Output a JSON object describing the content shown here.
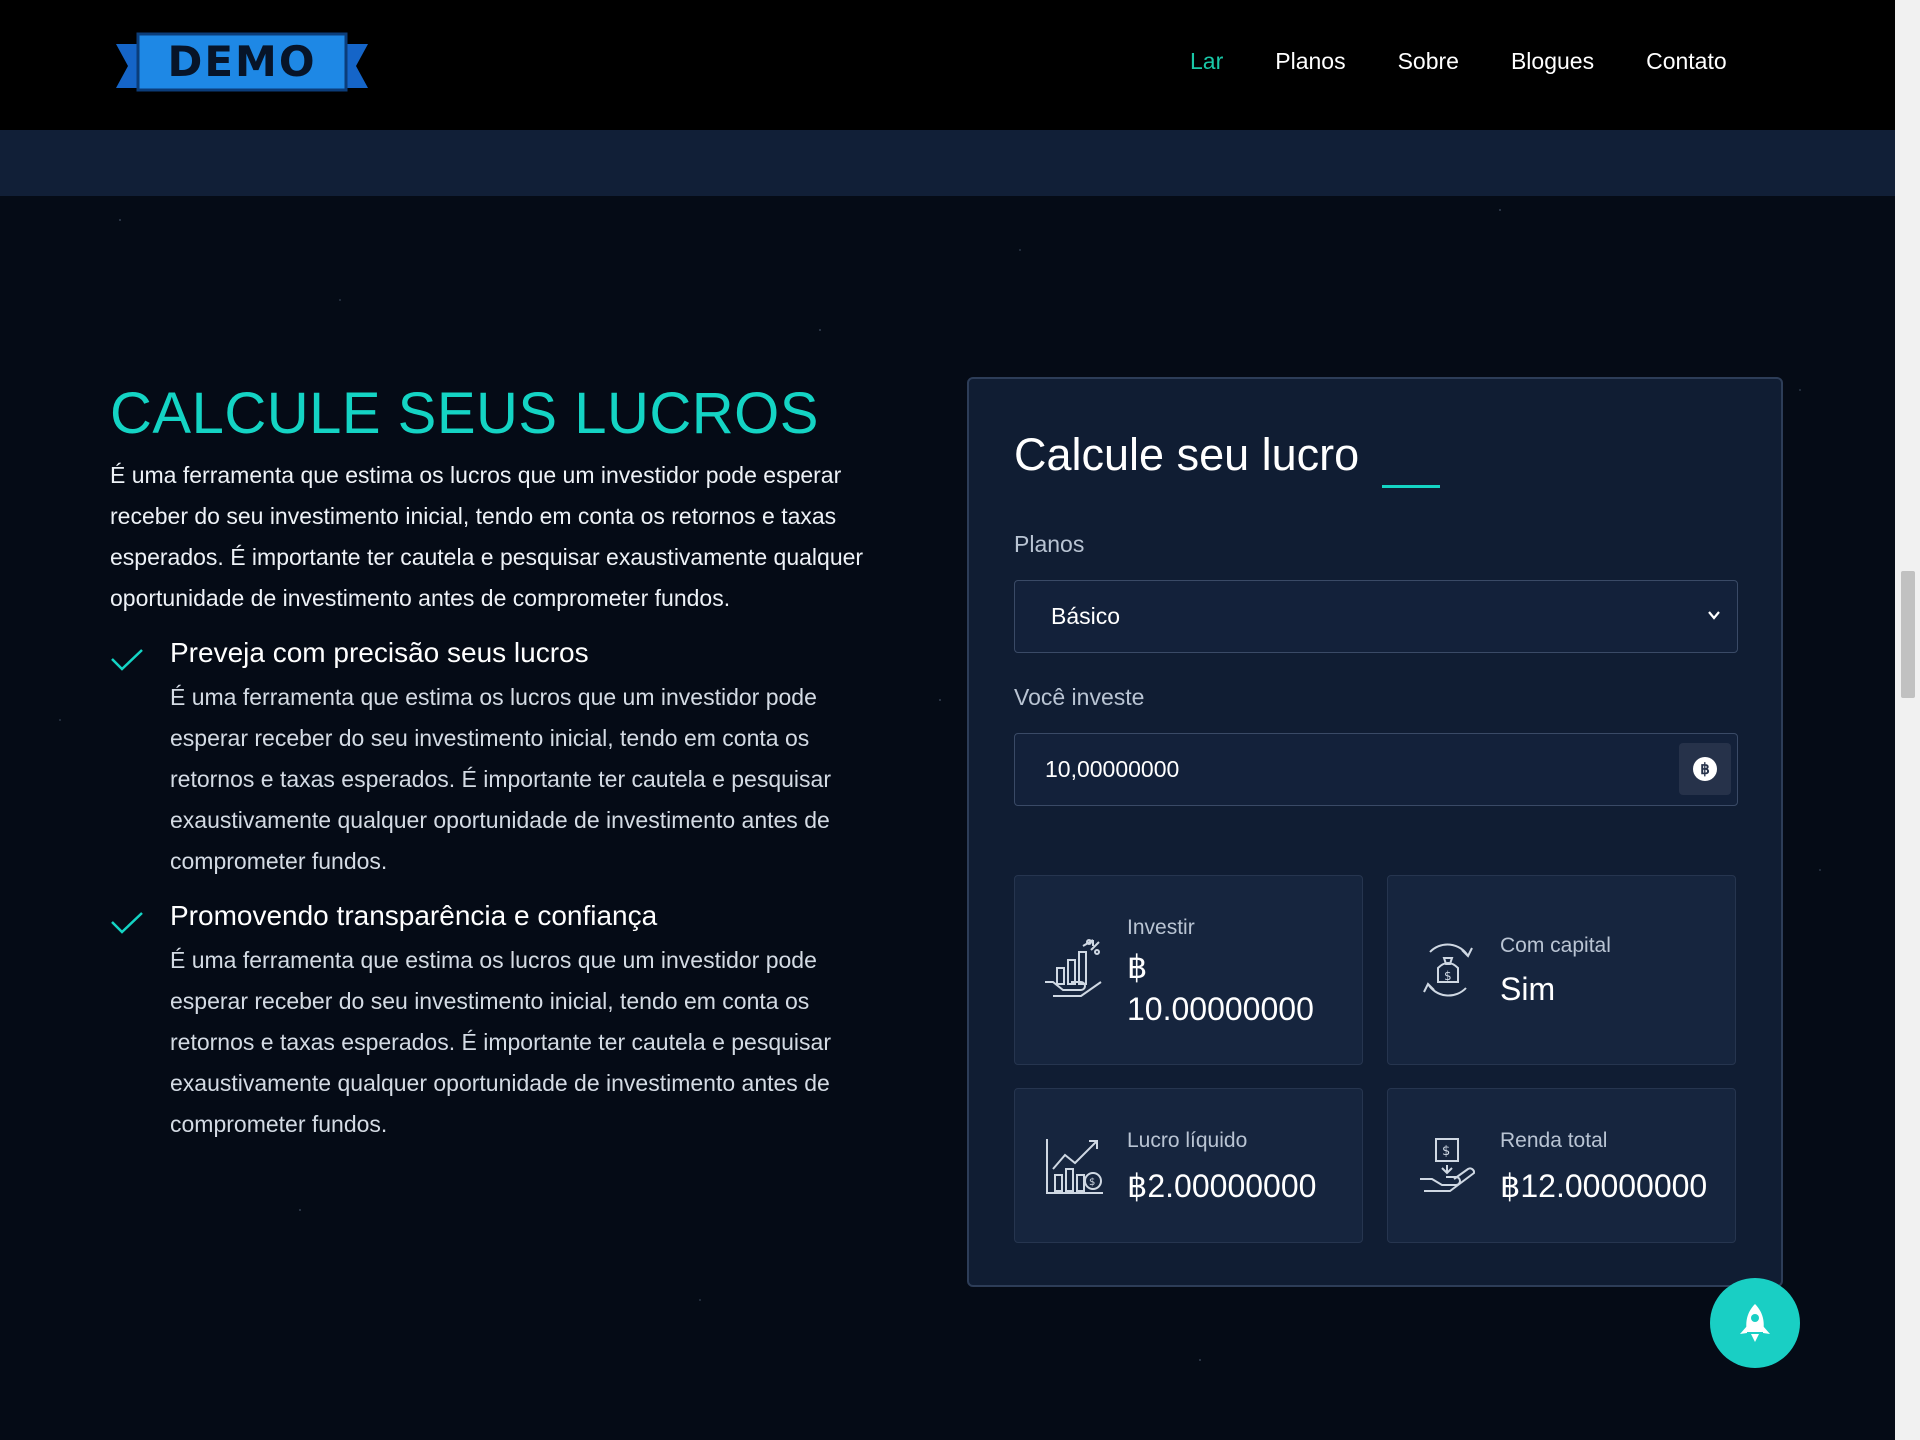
{
  "header": {
    "logo_text": "DEMO",
    "nav": [
      {
        "label": "Lar",
        "active": true
      },
      {
        "label": "Planos"
      },
      {
        "label": "Sobre"
      },
      {
        "label": "Blogues"
      },
      {
        "label": "Contato"
      }
    ]
  },
  "section": {
    "title": "CALCULE SEUS LUCROS",
    "description": "É uma ferramenta que estima os lucros que um investidor pode esperar receber do seu investimento inicial, tendo em conta os retornos e taxas esperados. É importante ter cautela e pesquisar exaustivamente qualquer oportunidade de investimento antes de comprometer fundos.",
    "features": [
      {
        "title": "Preveja com precisão seus lucros",
        "text": "É uma ferramenta que estima os lucros que um investidor pode esperar receber do seu investimento inicial, tendo em conta os retornos e taxas esperados. É importante ter cautela e pesquisar exaustivamente qualquer oportunidade de investimento antes de comprometer fundos."
      },
      {
        "title": "Promovendo transparência e confiança",
        "text": "É uma ferramenta que estima os lucros que um investidor pode esperar receber do seu investimento inicial, tendo em conta os retornos e taxas esperados. É importante ter cautela e pesquisar exaustivamente qualquer oportunidade de investimento antes de comprometer fundos."
      }
    ]
  },
  "calculator": {
    "title": "Calcule seu lucro",
    "plans_label": "Planos",
    "plan_selected": "Básico",
    "invest_label": "Você investe",
    "invest_value": "10,00000000",
    "coin_symbol": "฿",
    "stats": {
      "invest": {
        "label": "Investir",
        "value_symbol": "฿",
        "value": "10.00000000"
      },
      "capital": {
        "label": "Com capital",
        "value": "Sim"
      },
      "net_profit": {
        "label": "Lucro líquido",
        "value": "฿2.00000000"
      },
      "total_income": {
        "label": "Renda total",
        "value": "฿12.00000000"
      }
    }
  },
  "colors": {
    "accent": "#14d4c4",
    "nav_active": "#19c7a7",
    "background": "#050b16",
    "card": "#101d33"
  },
  "icons": [
    "check-icon",
    "chevron-down-icon",
    "bitcoin-icon",
    "investment-icon",
    "capital-icon",
    "profit-chart-icon",
    "income-hand-icon",
    "rocket-icon"
  ]
}
